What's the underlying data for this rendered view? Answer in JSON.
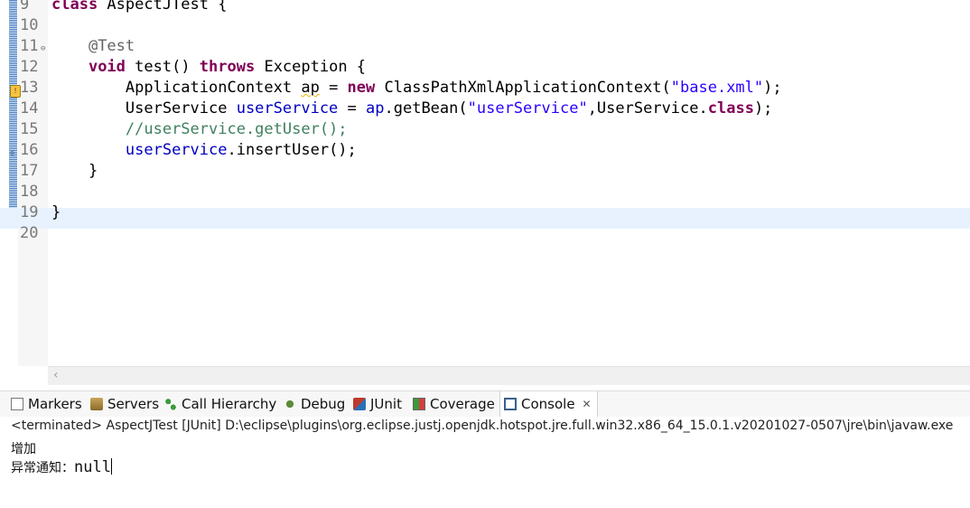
{
  "editor": {
    "lines": [
      {
        "num": "9",
        "tokens": [
          {
            "t": "class",
            "c": "kw"
          },
          {
            "t": " AspectJTest ",
            "c": ""
          },
          {
            "t": "{",
            "c": ""
          }
        ]
      },
      {
        "num": "10",
        "tokens": []
      },
      {
        "num": "11",
        "tokens": [
          {
            "t": "    ",
            "c": ""
          },
          {
            "t": "@Test",
            "c": "ann"
          }
        ]
      },
      {
        "num": "12",
        "tokens": [
          {
            "t": "    ",
            "c": ""
          },
          {
            "t": "void",
            "c": "kw"
          },
          {
            "t": " test() ",
            "c": ""
          },
          {
            "t": "throws",
            "c": "kw"
          },
          {
            "t": " Exception {",
            "c": ""
          }
        ]
      },
      {
        "num": "13",
        "tokens": [
          {
            "t": "        ApplicationContext ",
            "c": ""
          },
          {
            "t": "ap",
            "c": "warn"
          },
          {
            "t": " = ",
            "c": ""
          },
          {
            "t": "new",
            "c": "kw"
          },
          {
            "t": " ClassPathXmlApplicationContext(",
            "c": ""
          },
          {
            "t": "\"base.xml\"",
            "c": "str"
          },
          {
            "t": ");",
            "c": ""
          }
        ]
      },
      {
        "num": "14",
        "tokens": [
          {
            "t": "        UserService ",
            "c": ""
          },
          {
            "t": "userService",
            "c": "fld"
          },
          {
            "t": " = ",
            "c": ""
          },
          {
            "t": "ap",
            "c": "fld"
          },
          {
            "t": ".getBean(",
            "c": ""
          },
          {
            "t": "\"userService\"",
            "c": "str"
          },
          {
            "t": ",UserService.",
            "c": ""
          },
          {
            "t": "class",
            "c": "kw"
          },
          {
            "t": ");",
            "c": ""
          }
        ]
      },
      {
        "num": "15",
        "tokens": [
          {
            "t": "        ",
            "c": ""
          },
          {
            "t": "//userService.getUser();",
            "c": "cmt"
          }
        ]
      },
      {
        "num": "16",
        "tokens": [
          {
            "t": "        ",
            "c": ""
          },
          {
            "t": "userService",
            "c": "fld"
          },
          {
            "t": ".insertUser();",
            "c": ""
          }
        ]
      },
      {
        "num": "17",
        "tokens": [
          {
            "t": "    }",
            "c": ""
          }
        ]
      },
      {
        "num": "18",
        "tokens": []
      },
      {
        "num": "19",
        "tokens": [
          {
            "t": "}",
            "c": ""
          }
        ],
        "current": true
      },
      {
        "num": "20",
        "tokens": []
      }
    ],
    "fold_marker": "⊖",
    "warning_marker": "!"
  },
  "scrollbar": {
    "left_arrow": "‹"
  },
  "views": {
    "tabs": [
      {
        "label": "Markers",
        "icon": "markers-icon"
      },
      {
        "label": "Servers",
        "icon": "servers-icon"
      },
      {
        "label": "Call Hierarchy",
        "icon": "call-hierarchy-icon"
      },
      {
        "label": "Debug",
        "icon": "debug-icon"
      },
      {
        "label": "JUnit",
        "icon": "junit-icon"
      },
      {
        "label": "Coverage",
        "icon": "coverage-icon"
      },
      {
        "label": "Console",
        "icon": "console-icon",
        "active": true
      }
    ],
    "close_glyph": "✕"
  },
  "console": {
    "status": "<terminated> AspectJTest [JUnit] D:\\eclipse\\plugins\\org.eclipse.justj.openjdk.hotspot.jre.full.win32.x86_64_15.0.1.v20201027-0507\\jre\\bin\\javaw.exe",
    "output_line1": "增加",
    "output_line2_prefix": "异常通知：",
    "output_line2_value": "null"
  }
}
